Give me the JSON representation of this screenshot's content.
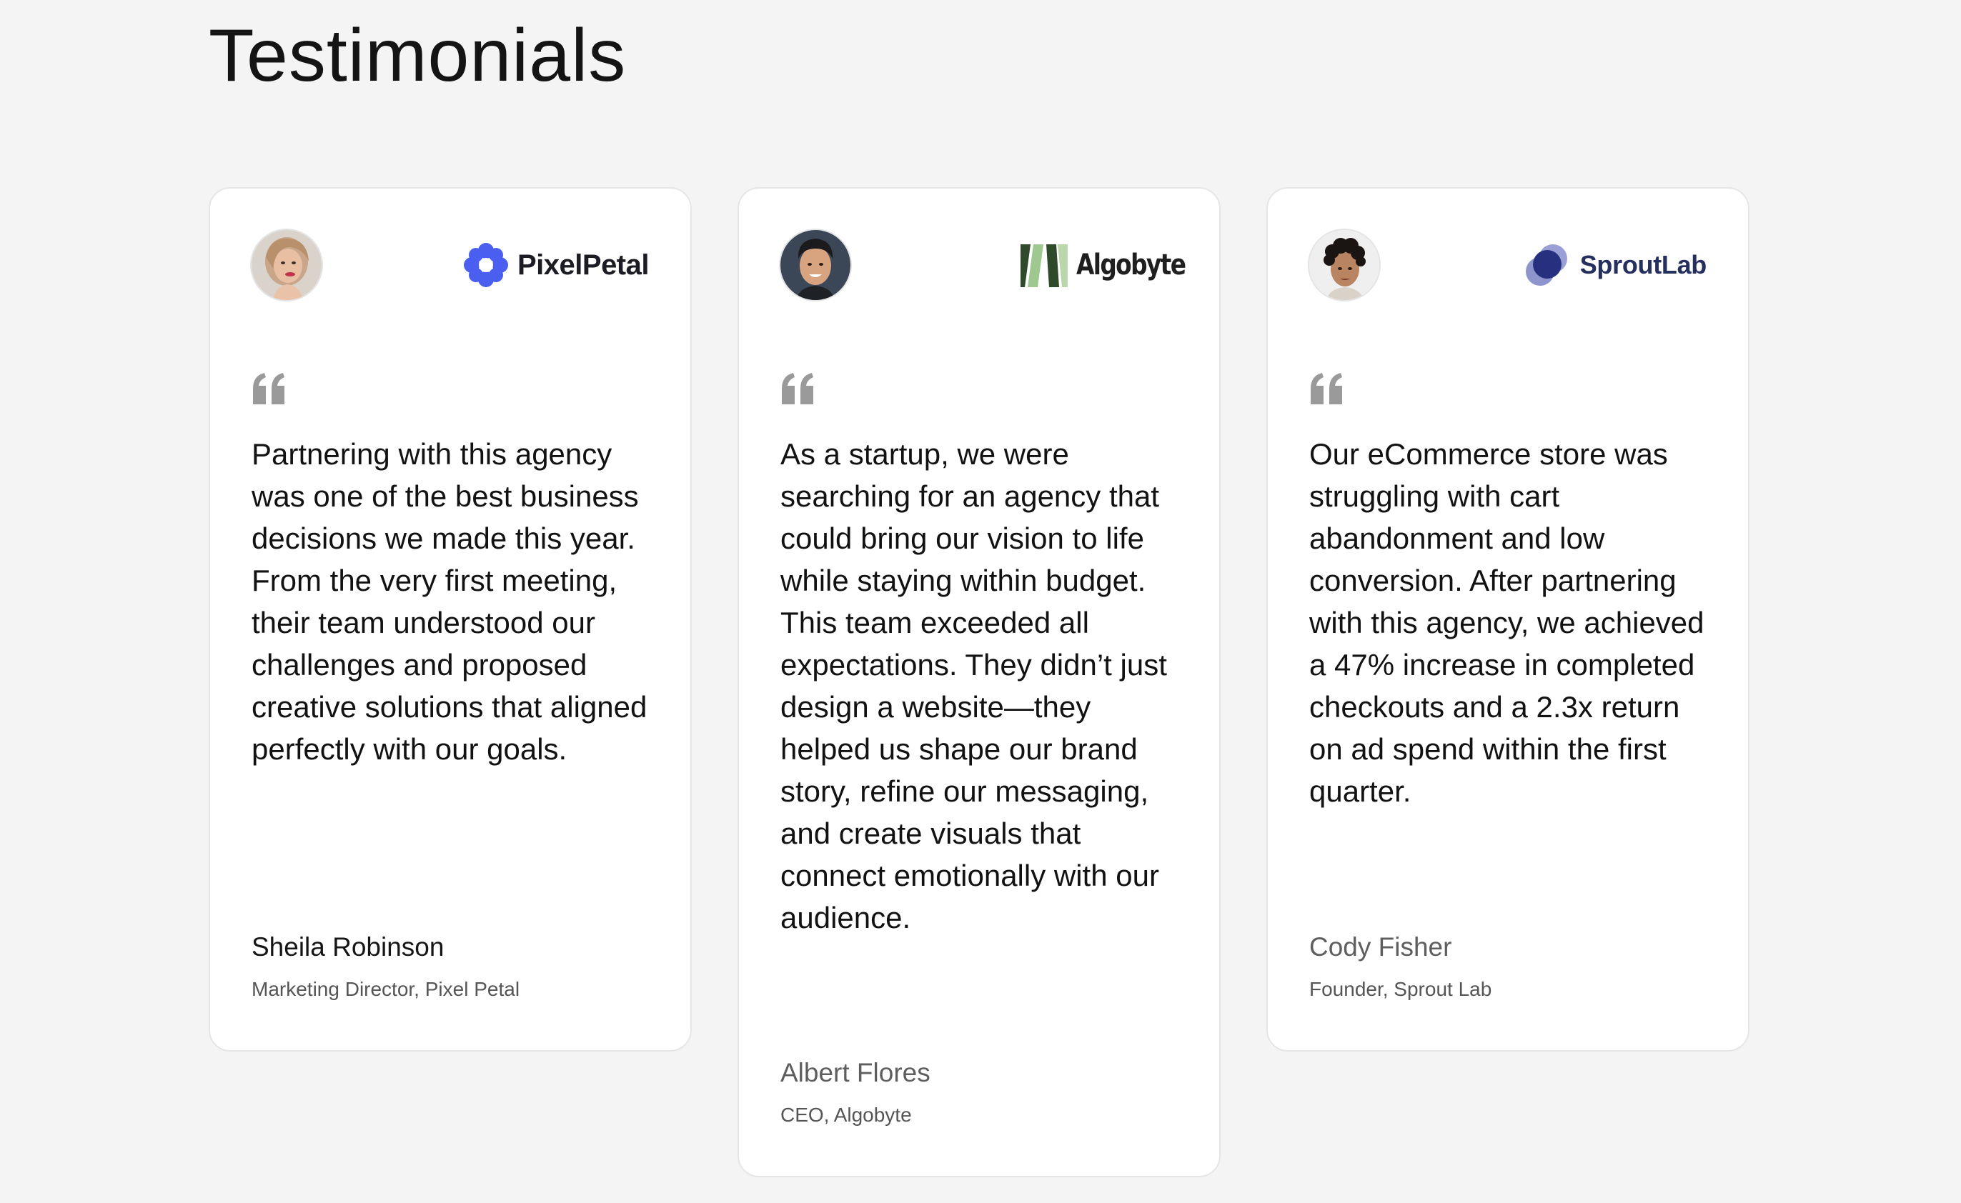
{
  "page": {
    "title": "Testimonials"
  },
  "colors": {
    "background": "#f4f4f4",
    "card": "#ffffff",
    "card_border": "#e6e6e6",
    "quote_icon": "#9a9a9a",
    "pixelpetal_brand": "#4a5ff0",
    "algobyte_brand": "#2f4a2b",
    "sproutlab_brand": "#26305f"
  },
  "testimonials": [
    {
      "avatar_icon": "woman-portrait-avatar",
      "company_logo": {
        "name": "PixelPetal",
        "icon": "flower-logo-icon"
      },
      "quote_icon": "quote-mark-icon",
      "quote": "Partnering with this agency was one of the best business decisions we made this year. From the very first meeting, their team understood our challenges and proposed creative solutions that aligned perfectly with our goals.",
      "name": "Sheila Robinson",
      "role": "Marketing Director, Pixel Petal"
    },
    {
      "avatar_icon": "man-portrait-avatar",
      "company_logo": {
        "name": "Algobyte",
        "icon": "stripes-logo-icon"
      },
      "quote_icon": "quote-mark-icon",
      "quote": "As a startup, we were searching for an agency that could bring our vision to life while staying within budget. This team exceeded all expectations. They didn’t just design a website—they helped us shape our brand story, refine our messaging, and create visuals that connect emotionally with our audience.",
      "name": "Albert Flores",
      "role": "CEO, Algobyte"
    },
    {
      "avatar_icon": "man-curly-hair-portrait-avatar",
      "company_logo": {
        "name": "SproutLab",
        "icon": "overlapping-circles-logo-icon"
      },
      "quote_icon": "quote-mark-icon",
      "quote": "Our eCommerce store was struggling with cart abandonment and low conversion. After partnering with this agency, we achieved a 47% increase in completed checkouts and a 2.3x return on ad spend within the first quarter.",
      "name": "Cody Fisher",
      "role": "Founder, Sprout Lab"
    }
  ]
}
